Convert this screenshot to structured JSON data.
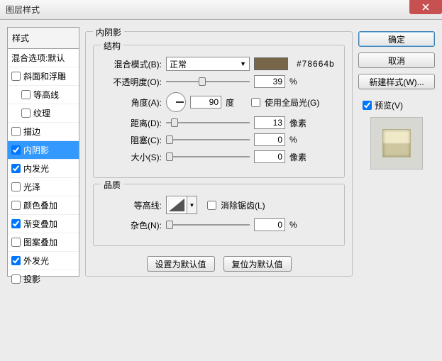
{
  "window": {
    "title": "图层样式"
  },
  "styles": {
    "header": "样式",
    "blending": "混合选项:默认",
    "items": [
      {
        "label": "斜面和浮雕",
        "checked": false,
        "indent": 0
      },
      {
        "label": "等高线",
        "checked": false,
        "indent": 1
      },
      {
        "label": "纹理",
        "checked": false,
        "indent": 1
      },
      {
        "label": "描边",
        "checked": false,
        "indent": 0
      },
      {
        "label": "内阴影",
        "checked": true,
        "indent": 0,
        "selected": true
      },
      {
        "label": "内发光",
        "checked": true,
        "indent": 0
      },
      {
        "label": "光泽",
        "checked": false,
        "indent": 0
      },
      {
        "label": "颜色叠加",
        "checked": false,
        "indent": 0
      },
      {
        "label": "渐变叠加",
        "checked": true,
        "indent": 0
      },
      {
        "label": "图案叠加",
        "checked": false,
        "indent": 0
      },
      {
        "label": "外发光",
        "checked": true,
        "indent": 0
      },
      {
        "label": "投影",
        "checked": false,
        "indent": 0
      }
    ]
  },
  "panel": {
    "title": "内阴影",
    "structure": {
      "legend": "结构",
      "blendmode_label": "混合模式(B):",
      "blendmode_value": "正常",
      "color_hex": "#78664b",
      "opacity_label": "不透明度(O):",
      "opacity_value": "39",
      "opacity_unit": "%",
      "angle_label": "角度(A):",
      "angle_value": "90",
      "angle_unit": "度",
      "global_light_label": "使用全局光(G)",
      "distance_label": "距离(D):",
      "distance_value": "13",
      "distance_unit": "像素",
      "choke_label": "阻塞(C):",
      "choke_value": "0",
      "choke_unit": "%",
      "size_label": "大小(S):",
      "size_value": "0",
      "size_unit": "像素"
    },
    "quality": {
      "legend": "品质",
      "contour_label": "等高线:",
      "antialias_label": "消除锯齿(L)",
      "noise_label": "杂色(N):",
      "noise_value": "0",
      "noise_unit": "%"
    },
    "buttons": {
      "make_default": "设置为默认值",
      "reset_default": "复位为默认值"
    }
  },
  "right": {
    "ok": "确定",
    "cancel": "取消",
    "new_style": "新建样式(W)...",
    "preview_label": "预览(V)"
  }
}
